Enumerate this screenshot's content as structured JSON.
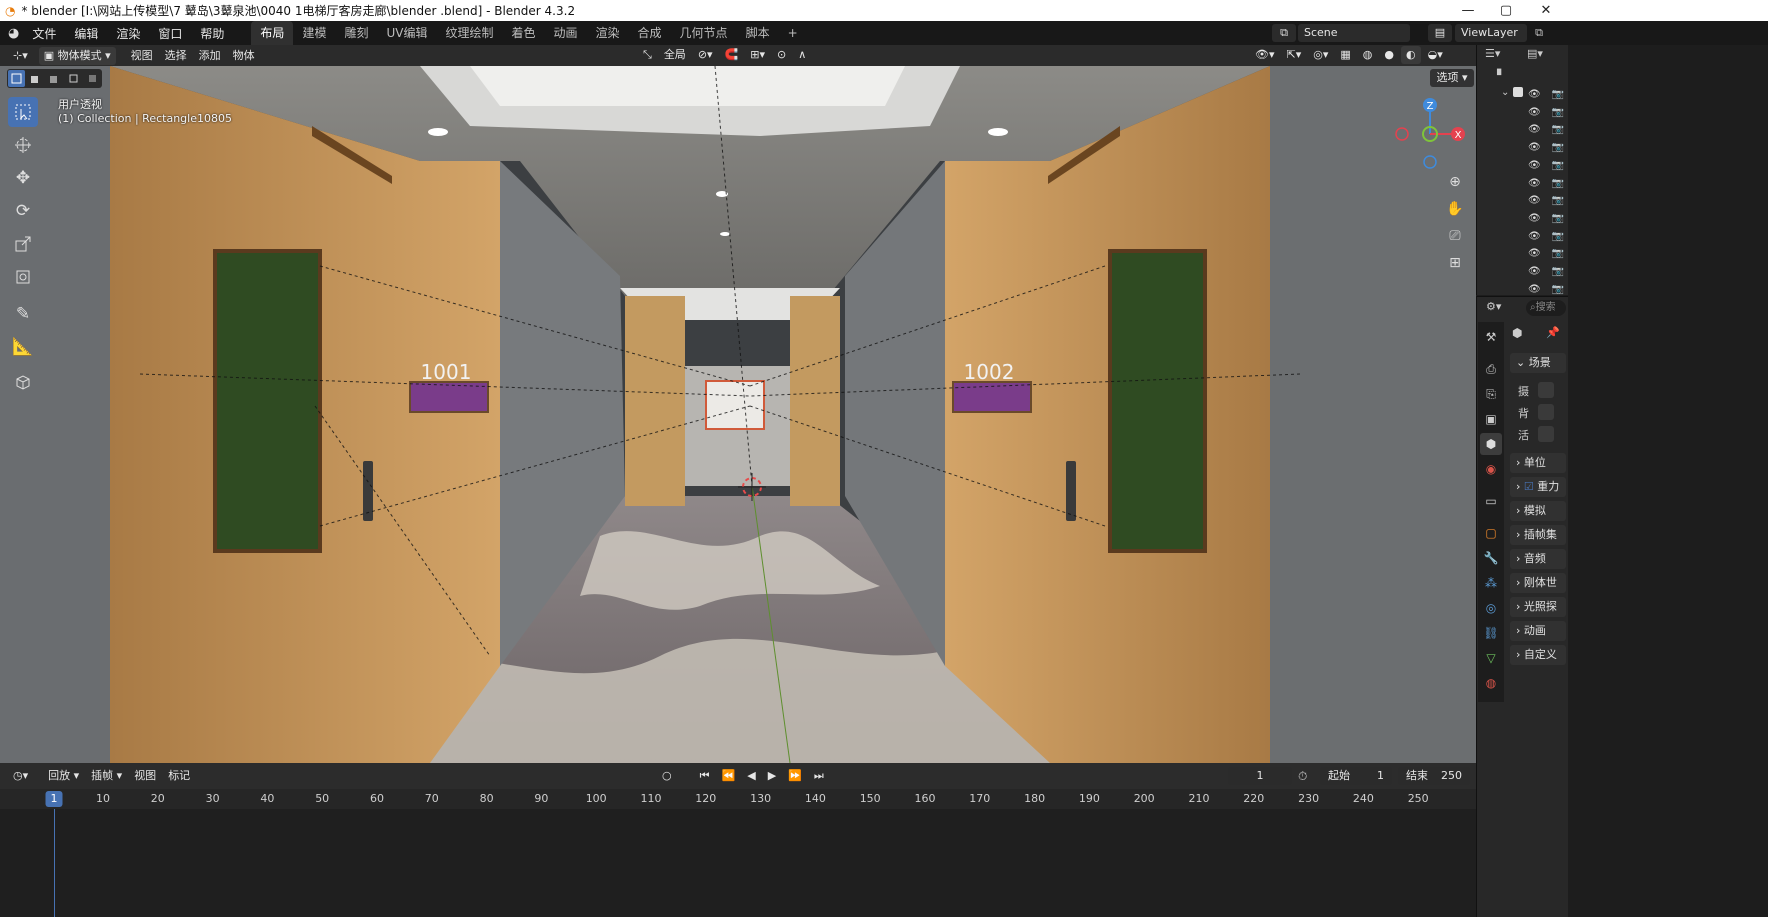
{
  "window": {
    "title": "* blender  [I:\\网站上传模型\\7 鼙岛\\3鼙泉池\\0040 1电梯厅客房走廊\\blender .blend] - Blender 4.3.2",
    "controls": {
      "minimize": "—",
      "maximize": "▢",
      "close": "✕"
    }
  },
  "menubar": {
    "items": [
      "文件",
      "编辑",
      "渲染",
      "窗口",
      "帮助"
    ],
    "workspaces": [
      "布局",
      "建模",
      "雕刻",
      "UV编辑",
      "纹理绘制",
      "着色",
      "动画",
      "渲染",
      "合成",
      "几何节点",
      "脚本"
    ],
    "active_workspace": "布局",
    "add_tab": "+",
    "scene_name": "Scene",
    "view_layer": "ViewLayer"
  },
  "viewport_header": {
    "mode": "物体模式",
    "menus": [
      "视图",
      "选择",
      "添加",
      "物体"
    ],
    "transform_orientation": "全局",
    "options_button": "选项"
  },
  "viewport": {
    "view_name": "用户透视",
    "collection_info": "(1) Collection | Rectangle10805",
    "room_numbers": [
      "1001",
      "1002"
    ],
    "gizmo": {
      "z": "Z",
      "x": "X",
      "y": "Y"
    },
    "colors": {
      "x_axis": "#e4424f",
      "y_axis": "#7fc43a",
      "z_axis": "#3f8bdc",
      "wood": "#c79a5c",
      "carpet_dark": "#4b4446",
      "carpet_light": "#bdb7ae",
      "wall_gray": "#6f7274",
      "ceiling": "#7c7b77"
    }
  },
  "toolbar": {
    "tools": [
      "select-box-icon",
      "cursor-icon",
      "move-icon",
      "rotate-icon",
      "scale-icon",
      "transform-icon",
      "annotate-icon",
      "measure-icon",
      "add-cube-icon"
    ]
  },
  "timeline": {
    "menus": [
      "回放",
      "插帧",
      "视图",
      "标记"
    ],
    "current_frame": "1",
    "start_label": "起始",
    "start_value": "1",
    "end_label": "结束",
    "end_value": "250",
    "ruler_ticks": [
      "10",
      "20",
      "30",
      "40",
      "50",
      "60",
      "70",
      "80",
      "90",
      "100",
      "110",
      "120",
      "130",
      "140",
      "150",
      "160",
      "170",
      "180",
      "190",
      "200",
      "210",
      "220",
      "230",
      "240",
      "250"
    ],
    "ruler_current": "1"
  },
  "properties": {
    "search_placeholder": "搜索",
    "scene_header": "场景",
    "scene_rows": [
      "摄",
      "背",
      "活"
    ],
    "sections": [
      "单位",
      "重力",
      "模拟",
      "插帧集",
      "音频",
      "刚体世",
      "光照探",
      "动画",
      "自定义"
    ],
    "gravity_checked": true
  }
}
